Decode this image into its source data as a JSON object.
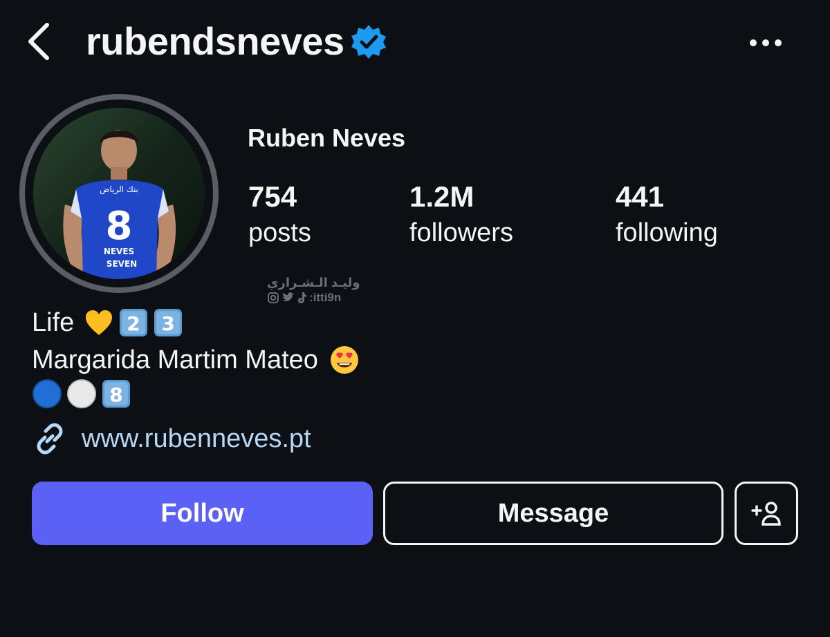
{
  "header": {
    "username": "rubendsneves",
    "verified": true
  },
  "profile": {
    "display_name": "Ruben Neves",
    "avatar_jersey_number": "8",
    "avatar_jersey_name": "NEVES",
    "avatar_sponsor": "SEVEN",
    "avatar_arabic": "بنك الرياض"
  },
  "stats": [
    {
      "value": "754",
      "label": "posts"
    },
    {
      "value": "1.2M",
      "label": "followers"
    },
    {
      "value": "441",
      "label": "following"
    }
  ],
  "watermark": {
    "name": "وليـد الـشـراري",
    "handle": ":itti9n"
  },
  "bio": {
    "line1": "Life",
    "line2": "Margarida Martim Mateo",
    "line1_emojis": [
      "yellow-heart-icon",
      "keycap-2-icon",
      "keycap-3-icon"
    ],
    "line2_emojis": [
      "heart-eyes-icon"
    ],
    "line3_emojis": [
      "blue-circle-icon",
      "white-circle-icon",
      "keycap-8-icon"
    ]
  },
  "link": {
    "url": "www.rubenneves.pt"
  },
  "actions": {
    "follow_label": "Follow",
    "message_label": "Message"
  },
  "colors": {
    "background": "#0c1014",
    "follow_button": "#5c61f5",
    "link": "#b6d8f5",
    "verified_badge": "#1d9bf0"
  }
}
